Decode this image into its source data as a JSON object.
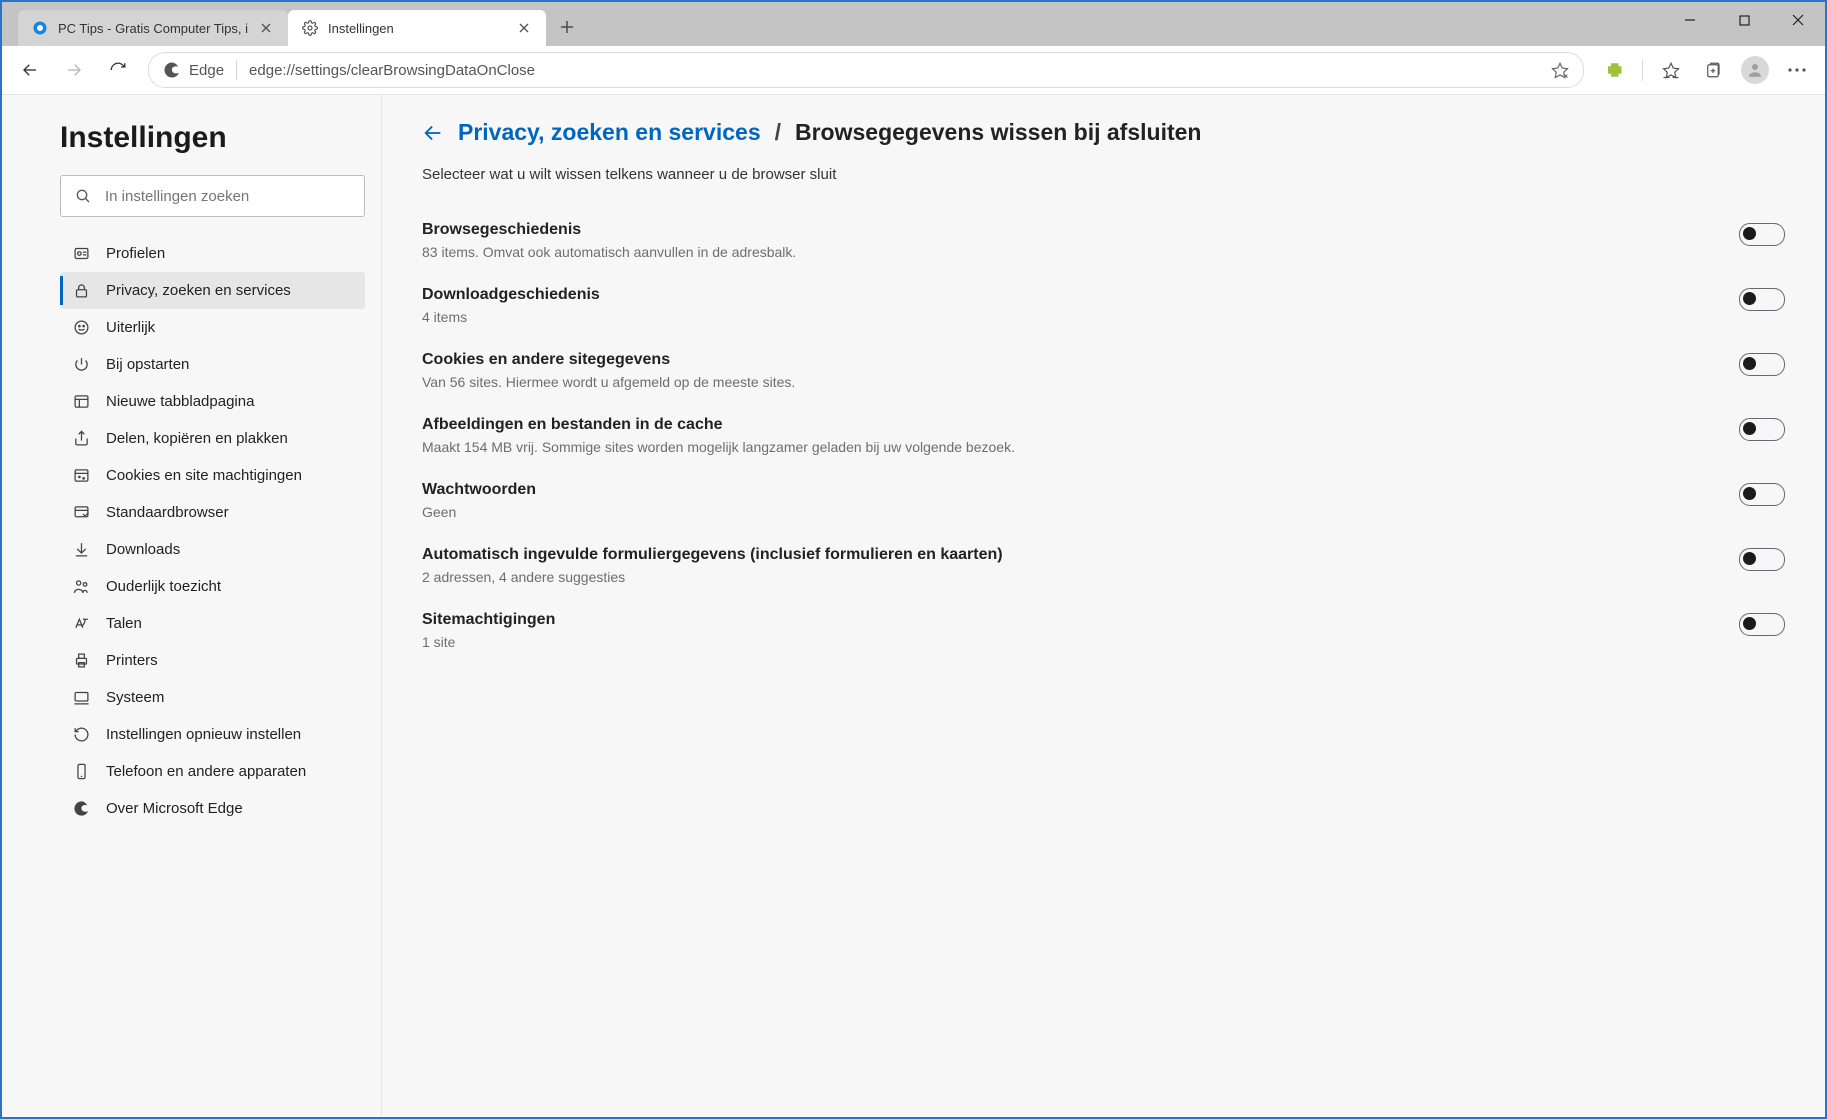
{
  "tabs": [
    {
      "title": "PC Tips - Gratis Computer Tips, i"
    },
    {
      "title": "Instellingen"
    }
  ],
  "omnibox": {
    "label": "Edge",
    "url": "edge://settings/clearBrowsingDataOnClose"
  },
  "sidebar": {
    "title": "Instellingen",
    "search_placeholder": "In instellingen zoeken",
    "items": [
      {
        "label": "Profielen"
      },
      {
        "label": "Privacy, zoeken en services"
      },
      {
        "label": "Uiterlijk"
      },
      {
        "label": "Bij opstarten"
      },
      {
        "label": "Nieuwe tabbladpagina"
      },
      {
        "label": "Delen, kopiëren en plakken"
      },
      {
        "label": "Cookies en site machtigingen"
      },
      {
        "label": "Standaardbrowser"
      },
      {
        "label": "Downloads"
      },
      {
        "label": "Ouderlijk toezicht"
      },
      {
        "label": "Talen"
      },
      {
        "label": "Printers"
      },
      {
        "label": "Systeem"
      },
      {
        "label": "Instellingen opnieuw instellen"
      },
      {
        "label": "Telefoon en andere apparaten"
      },
      {
        "label": "Over Microsoft Edge"
      }
    ]
  },
  "page": {
    "breadcrumb_link": "Privacy, zoeken en services",
    "breadcrumb_sep": "/",
    "breadcrumb_current": "Browsegegevens wissen bij afsluiten",
    "intro": "Selecteer wat u wilt wissen telkens wanneer u de browser sluit",
    "settings": [
      {
        "title": "Browsegeschiedenis",
        "desc": "83 items. Omvat ook automatisch aanvullen in de adresbalk."
      },
      {
        "title": "Downloadgeschiedenis",
        "desc": "4 items"
      },
      {
        "title": "Cookies en andere sitegegevens",
        "desc": "Van 56 sites. Hiermee wordt u afgemeld op de meeste sites."
      },
      {
        "title": "Afbeeldingen en bestanden in de cache",
        "desc": "Maakt 154 MB vrij. Sommige sites worden mogelijk langzamer geladen bij uw volgende bezoek."
      },
      {
        "title": "Wachtwoorden",
        "desc": "Geen"
      },
      {
        "title": "Automatisch ingevulde formuliergegevens (inclusief formulieren en kaarten)",
        "desc": "2 adressen, 4 andere suggesties"
      },
      {
        "title": "Sitemachtigingen",
        "desc": "1 site"
      }
    ]
  }
}
